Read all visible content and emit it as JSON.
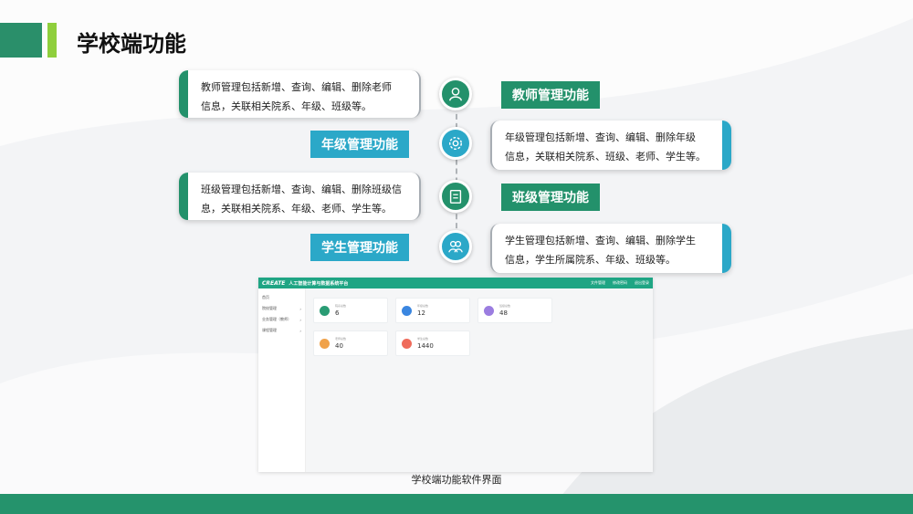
{
  "slide": {
    "title": "学校端功能",
    "caption": "学校端功能软件界面"
  },
  "colors": {
    "green": "#23916b",
    "blue": "#2ba8c8",
    "accent": "#8fcf3c"
  },
  "features": [
    {
      "label": "教师管理功能",
      "icon": "teacher-icon",
      "desc_line1": "教师管理包括新增、查询、编辑、删除老师",
      "desc_line2": "信息，关联相关院系、年级、班级等。"
    },
    {
      "label": "年级管理功能",
      "icon": "gear-icon",
      "desc_line1": "年级管理包括新增、查询、编辑、删除年级",
      "desc_line2": "信息，关联相关院系、班级、老师、学生等。"
    },
    {
      "label": "班级管理功能",
      "icon": "clipboard-icon",
      "desc_line1": "班级管理包括新增、查询、编辑、删除班级信",
      "desc_line2": "息，关联相关院系、年级、老师、学生等。"
    },
    {
      "label": "学生管理功能",
      "icon": "students-icon",
      "desc_line1": "学生管理包括新增、查询、编辑、删除学生",
      "desc_line2": "信息，学生所属院系、年级、班级等。"
    }
  ],
  "app": {
    "logo": "CREATE",
    "title": "人工智能计算与数据系统平台",
    "header_actions": [
      "文件管理",
      "修改密码",
      "退出登录"
    ],
    "sidebar": [
      "首页",
      "院校管理",
      "业务管理（教师）",
      "课程管理"
    ],
    "stats": [
      {
        "label": "院系总数",
        "value": "6",
        "color": "#2a9c74"
      },
      {
        "label": "年级总数",
        "value": "12",
        "color": "#3a86e0"
      },
      {
        "label": "班级总数",
        "value": "48",
        "color": "#9b7de0"
      },
      {
        "label": "老师总数",
        "value": "40",
        "color": "#f0a24a"
      },
      {
        "label": "学生总数",
        "value": "1440",
        "color": "#ef6b5b"
      }
    ]
  }
}
